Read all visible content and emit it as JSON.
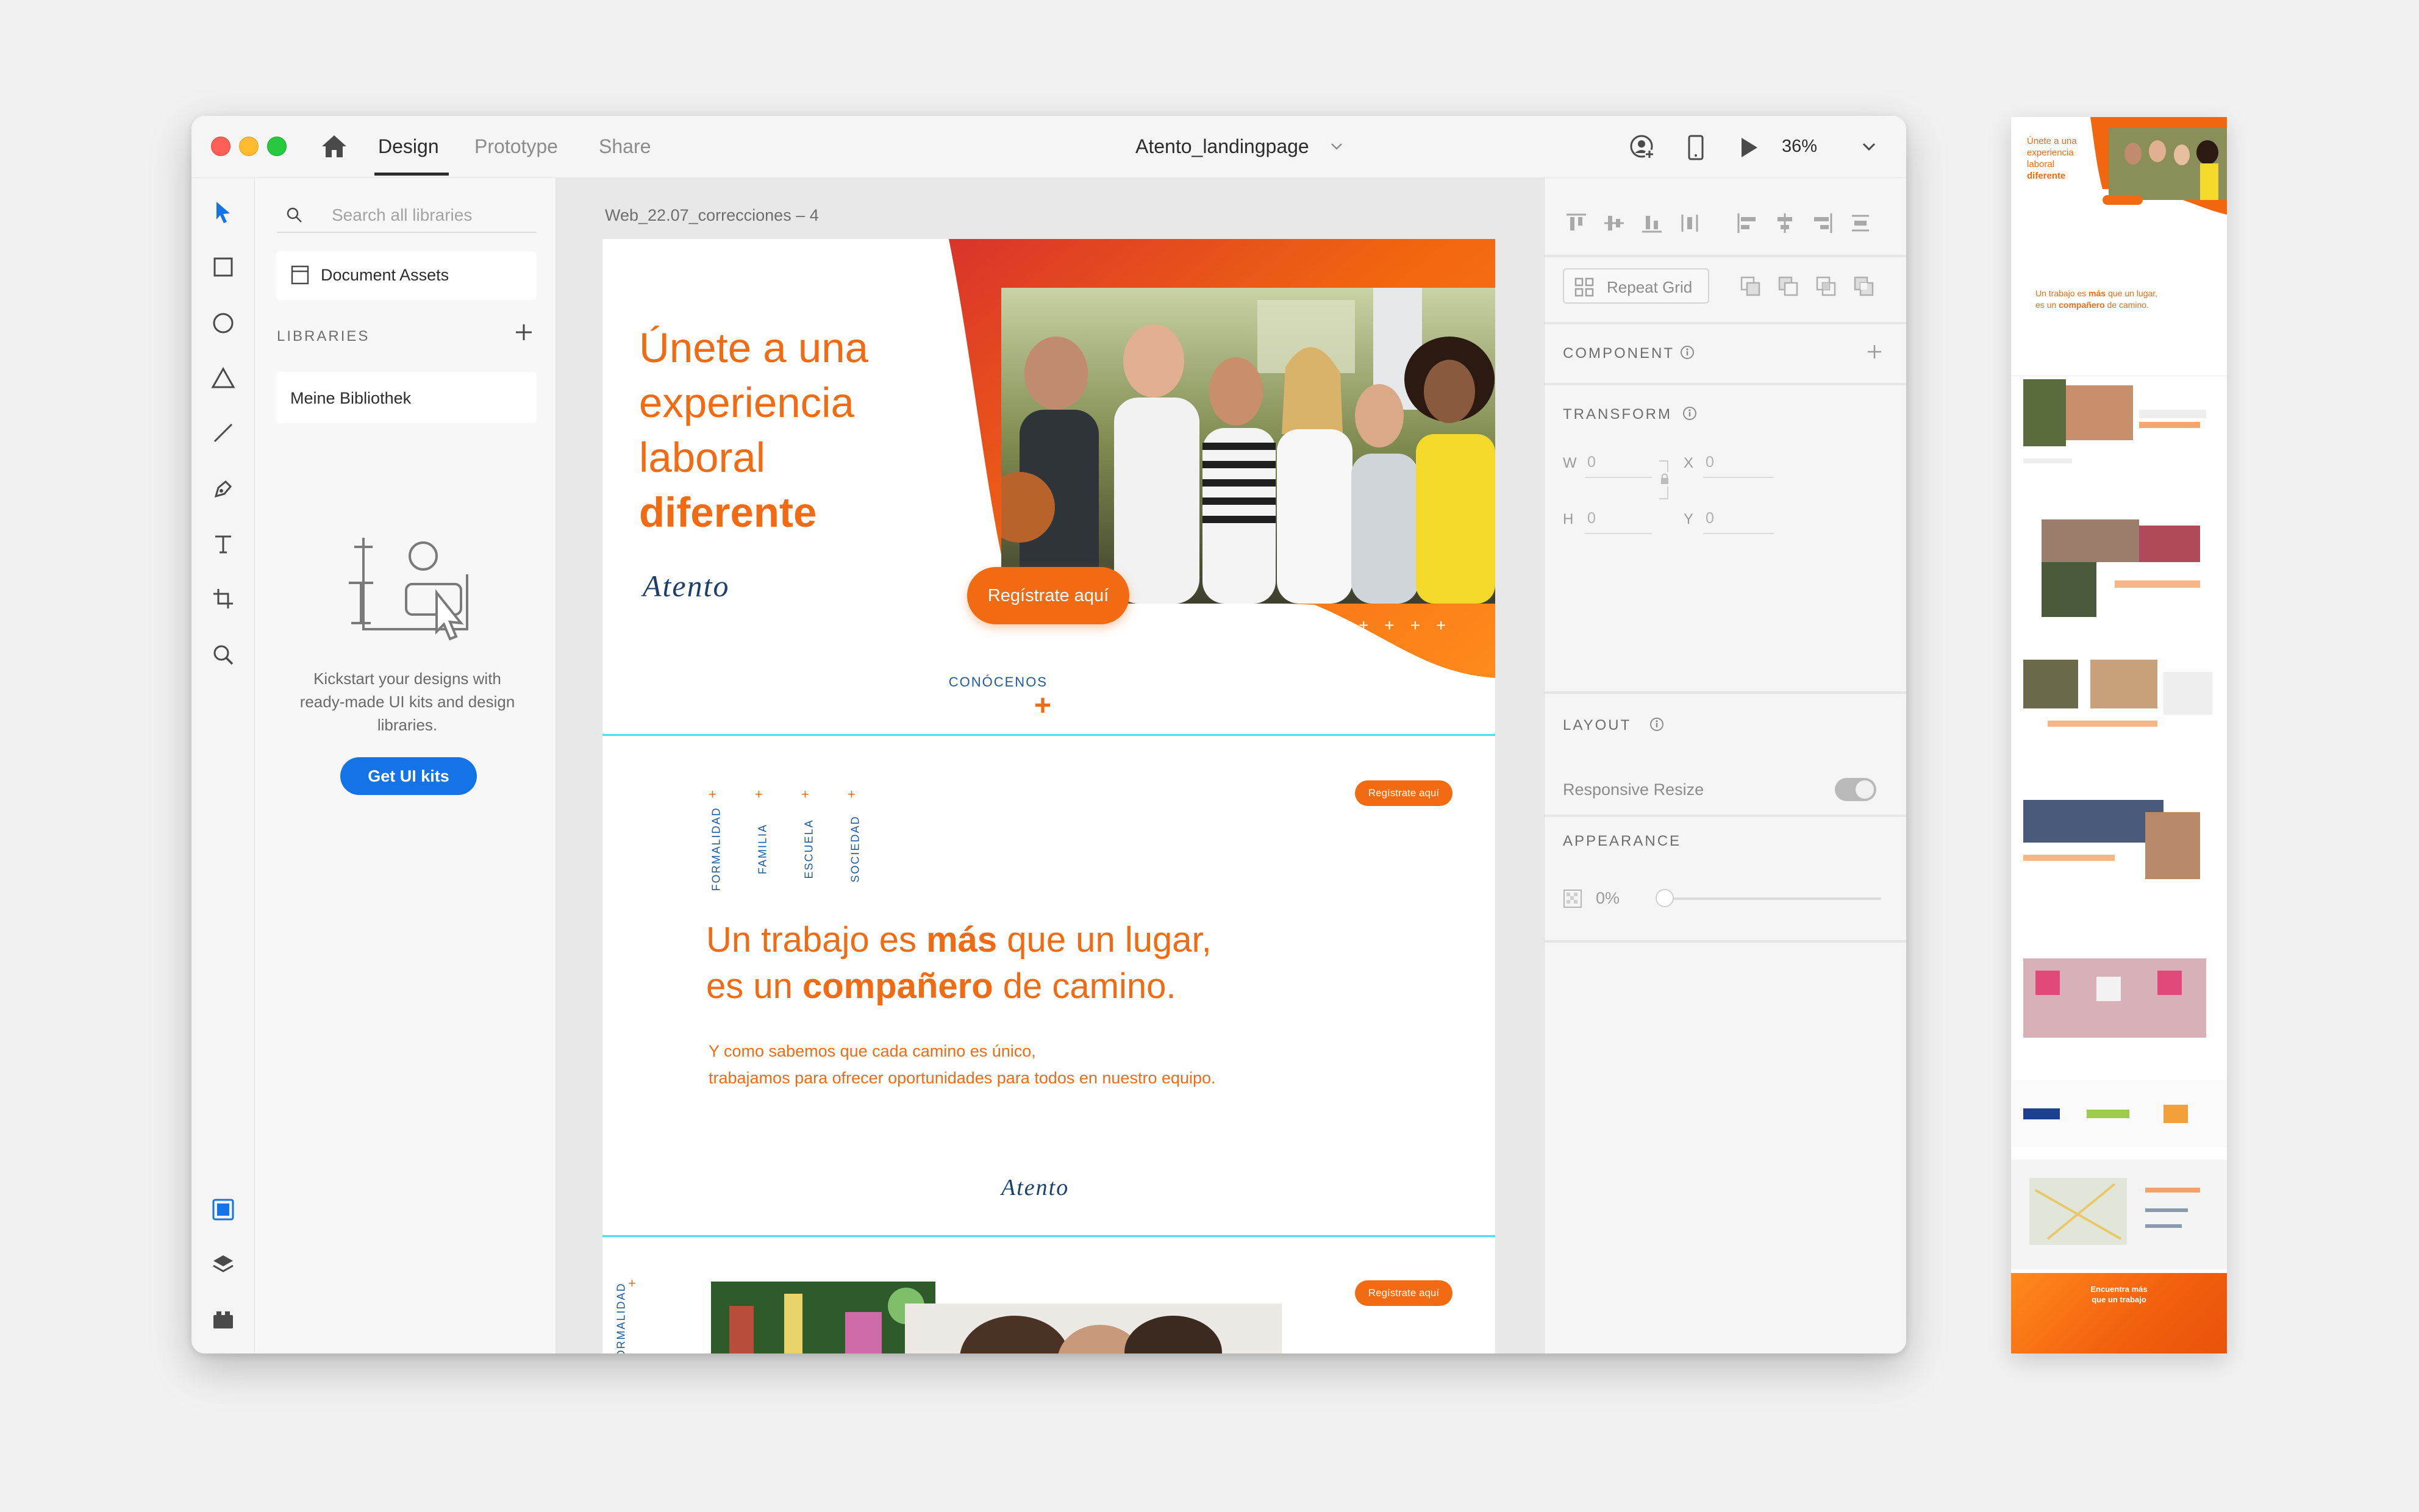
{
  "app": {
    "tabs": [
      {
        "label": "Design",
        "active": true
      },
      {
        "label": "Prototype",
        "active": false
      },
      {
        "label": "Share",
        "active": false
      }
    ],
    "document_title": "Atento_landingpage",
    "zoom": "36%"
  },
  "toolbar": {
    "tools": [
      "select-tool",
      "rectangle-tool",
      "ellipse-tool",
      "polygon-tool",
      "line-tool",
      "pen-tool",
      "text-tool",
      "artboard-tool",
      "zoom-tool"
    ],
    "bottom": [
      "assets-panel",
      "layers-panel",
      "plugins-panel"
    ]
  },
  "libraries": {
    "search_placeholder": "Search all libraries",
    "document_assets": "Document Assets",
    "heading": "LIBRARIES",
    "library_item": "Meine Bibliothek",
    "kickstart_text": "Kickstart your designs with ready-made UI kits and design libraries.",
    "get_kits_label": "Get UI kits"
  },
  "canvas": {
    "artboard_name": "Web_22.07_correcciones – 4",
    "hero": {
      "title_lines": [
        "Únete a una",
        "experiencia",
        "laboral"
      ],
      "title_bold": "diferente",
      "logo": "Atento",
      "cta": "Regístrate aquí",
      "stars": "++++",
      "conocenos": "CONÓCENOS",
      "conocenos_plus": "+"
    },
    "section2": {
      "cta": "Regístrate aquí",
      "categories": [
        "FORMALIDAD",
        "FAMILIA",
        "ESCUELA",
        "SOCIEDAD"
      ],
      "star": "+",
      "title_line1_pre": "Un trabajo es ",
      "title_line1_bold": "más",
      "title_line1_post": " que un lugar,",
      "title_line2_pre": "es un ",
      "title_line2_bold": "compañero",
      "title_line2_post": " de camino.",
      "body_line1": "Y como sabemos que cada camino es único,",
      "body_line2": "trabajamos para ofrecer oportunidades para todos en nuestro equipo.",
      "logo": "Atento"
    },
    "section3": {
      "cta": "Regístrate aquí",
      "vertical_label": "FORMALIDAD",
      "star": "+"
    }
  },
  "inspector": {
    "repeat_grid": "Repeat Grid",
    "component_heading": "COMPONENT",
    "transform_heading": "TRANSFORM",
    "fields": [
      {
        "label": "W",
        "value": "0"
      },
      {
        "label": "X",
        "value": "0"
      },
      {
        "label": "H",
        "value": "0"
      },
      {
        "label": "Y",
        "value": "0"
      }
    ],
    "layout_heading": "LAYOUT",
    "responsive_resize": "Responsive Resize",
    "responsive_resize_on": false,
    "appearance_heading": "APPEARANCE",
    "opacity": "0%",
    "opacity_value": 0
  },
  "preview": {
    "title_lines": [
      "Únete a una",
      "experiencia",
      "laboral"
    ],
    "title_bold": "diferente",
    "section_line1_pre": "Un trabajo es ",
    "section_line1_bold": "más",
    "section_line1_post": " que un lugar,",
    "section_line2_pre": "es un ",
    "section_line2_bold": "compañero",
    "section_line2_post": " de camino.",
    "footer_line1": "Encuentra más",
    "footer_line2": "que un trabajo"
  },
  "colors": {
    "accent_orange": "#f26b12",
    "brand_blue": "#1d3f6e",
    "xd_blue": "#1473e6",
    "artboard_divider": "#45e0f2"
  }
}
